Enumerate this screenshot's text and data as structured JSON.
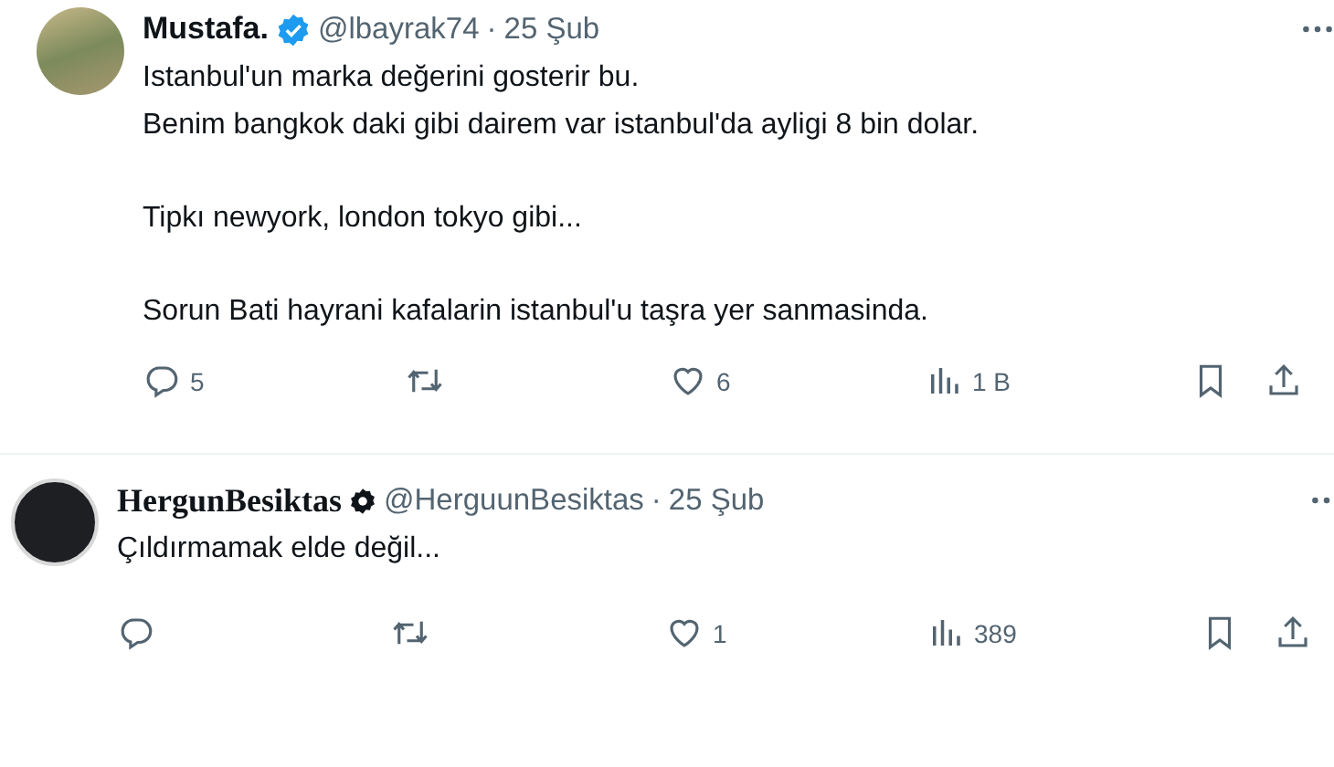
{
  "tweets": [
    {
      "kind": "verified",
      "name": "Mustafa.",
      "handle": "@lbayrak74",
      "separator": "·",
      "date": "25 Şub",
      "avatar": {
        "kind": "photo"
      },
      "paragraphs": [
        [
          "Istanbul'un marka değerini gosterir bu.",
          "Benim bangkok daki gibi dairem var istanbul'da ayligi 8 bin dolar."
        ],
        [
          "Tipkı newyork, london tokyo gibi..."
        ],
        [
          "Sorun Bati hayrani kafalarin istanbul'u taşra yer sanmasinda."
        ]
      ],
      "actions": [
        {
          "kind": "reply",
          "count": "5"
        },
        {
          "kind": "repost"
        },
        {
          "kind": "like",
          "count": "6"
        },
        {
          "kind": "views",
          "count": "1 B"
        },
        {
          "kind": "bookmark"
        },
        {
          "kind": "share"
        }
      ]
    },
    {
      "kind": "affiliate",
      "name": "HergunBesiktas",
      "handle": "@HerguunBesiktas",
      "separator": "·",
      "date": "25 Şub",
      "avatar": {
        "kind": "logo"
      },
      "paragraphs": [
        [
          "Çıldırmamak elde değil..."
        ]
      ],
      "actions": [
        {
          "kind": "reply"
        },
        {
          "kind": "repost"
        },
        {
          "kind": "like",
          "count": "1"
        },
        {
          "kind": "views",
          "count": "389"
        },
        {
          "kind": "bookmark"
        },
        {
          "kind": "share"
        }
      ]
    }
  ]
}
